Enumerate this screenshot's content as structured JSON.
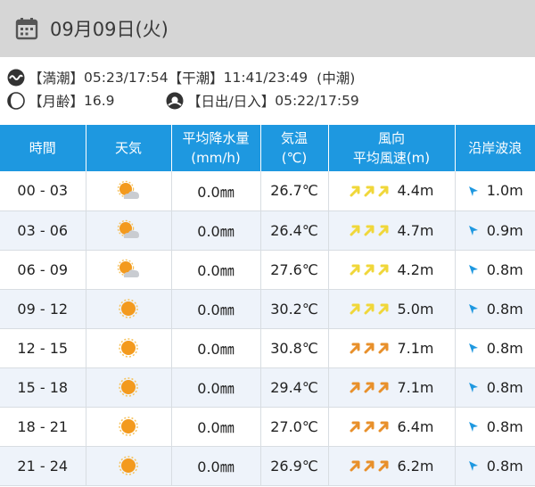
{
  "header": {
    "date": "09月09日(火)"
  },
  "tide": {
    "high_label": "【満潮】",
    "high_value": "05:23/17:54",
    "low_label": "【干潮】",
    "low_value": "11:41/23:49",
    "type": "(中潮)",
    "moon_label": "【月齢】",
    "moon_value": "16.9",
    "sun_label": "【日出/日入】",
    "sun_value": "05:22/17:59"
  },
  "table": {
    "headers": {
      "time": "時間",
      "weather": "天気",
      "precip_1": "平均降水量",
      "precip_2": "(mm/h)",
      "temp_1": "気温",
      "temp_2": "(℃)",
      "wind_1": "風向",
      "wind_2": "平均風速(m)",
      "wave": "沿岸波浪"
    },
    "rows": [
      {
        "time": "00 - 03",
        "weather": "partly-cloudy-icon",
        "precip": "0.0㎜",
        "temp": "26.7℃",
        "wind_color": "yellow",
        "wind": "4.4m",
        "wave": "1.0m"
      },
      {
        "time": "03 - 06",
        "weather": "partly-cloudy-icon",
        "precip": "0.0㎜",
        "temp": "26.4℃",
        "wind_color": "yellow",
        "wind": "4.7m",
        "wave": "0.9m"
      },
      {
        "time": "06 - 09",
        "weather": "partly-cloudy-icon",
        "precip": "0.0㎜",
        "temp": "27.6℃",
        "wind_color": "yellow",
        "wind": "4.2m",
        "wave": "0.8m"
      },
      {
        "time": "09 - 12",
        "weather": "sunny-icon",
        "precip": "0.0㎜",
        "temp": "30.2℃",
        "wind_color": "yellow",
        "wind": "5.0m",
        "wave": "0.8m"
      },
      {
        "time": "12 - 15",
        "weather": "sunny-icon",
        "precip": "0.0㎜",
        "temp": "30.8℃",
        "wind_color": "orange",
        "wind": "7.1m",
        "wave": "0.8m"
      },
      {
        "time": "15 - 18",
        "weather": "sunny-icon",
        "precip": "0.0㎜",
        "temp": "29.4℃",
        "wind_color": "orange",
        "wind": "7.1m",
        "wave": "0.8m"
      },
      {
        "time": "18 - 21",
        "weather": "sunny-icon",
        "precip": "0.0㎜",
        "temp": "27.0℃",
        "wind_color": "orange",
        "wind": "6.4m",
        "wave": "0.8m"
      },
      {
        "time": "21 - 24",
        "weather": "sunny-icon",
        "precip": "0.0㎜",
        "temp": "26.9℃",
        "wind_color": "orange",
        "wind": "6.2m",
        "wave": "0.8m"
      }
    ]
  },
  "colors": {
    "header_bg": "#d6d6d6",
    "table_header": "#1e98e0",
    "row_alt": "#eef3fa",
    "wind_yellow": "#f0d73a",
    "wind_orange": "#e8902b",
    "wave_arrow": "#1e98e0",
    "sun": "#f39a1e"
  }
}
